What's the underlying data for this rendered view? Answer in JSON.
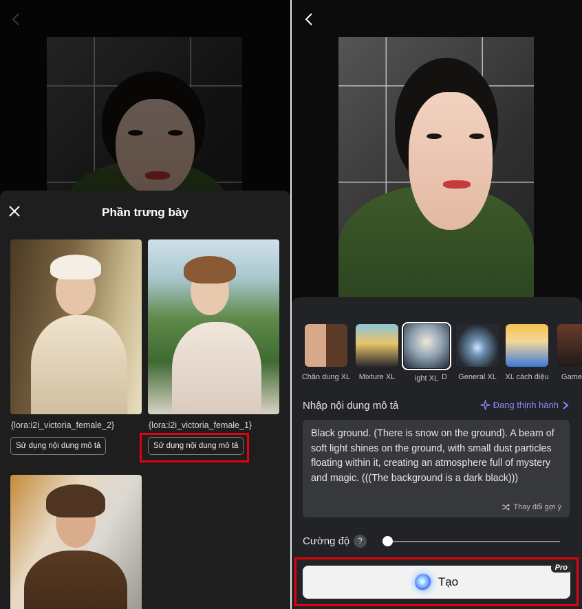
{
  "left": {
    "sheet_title": "Phần trưng bày",
    "cards": [
      {
        "lora": "{lora:i2i_victoria_female_2}",
        "button": "Sử dụng nội dung mô tả"
      },
      {
        "lora": "{lora:i2i_victoria_female_1}",
        "button": "Sử dụng nội dung mô tả"
      },
      {
        "lora": "",
        "button": ""
      }
    ]
  },
  "right": {
    "styles": [
      {
        "label": "Chân dung XL",
        "icon": "portrait-style-thumb"
      },
      {
        "label": "Mixture XL",
        "icon": "mixture-style-thumb"
      },
      {
        "label": "ight XL",
        "icon": "light-style-thumb",
        "selected": true
      },
      {
        "label": "D",
        "icon": "partial-style-thumb"
      },
      {
        "label": "General XL",
        "icon": "general-style-thumb"
      },
      {
        "label": "XL cách điệu",
        "icon": "comic-style-thumb"
      },
      {
        "label": "Game",
        "icon": "game-style-thumb"
      }
    ],
    "prompt_label": "Nhập nội dung mô tả",
    "trending_label": "Đang thịnh hành",
    "prompt_text": "Black ground. (There is snow on the ground). A beam of soft light shines on the ground, with small dust particles floating within it, creating an atmosphere full of mystery and magic. (((The background is a dark black)))",
    "suggest_label": "Thay đổi gợi ý",
    "strength_label": "Cường độ",
    "help_symbol": "?",
    "strength_value": 0.02,
    "create_label": "Tạo",
    "pro_badge": "Pro"
  },
  "colors": {
    "accent": "#8e88ff",
    "highlight": "#e3000f",
    "sheet": "#1e1e1e"
  }
}
